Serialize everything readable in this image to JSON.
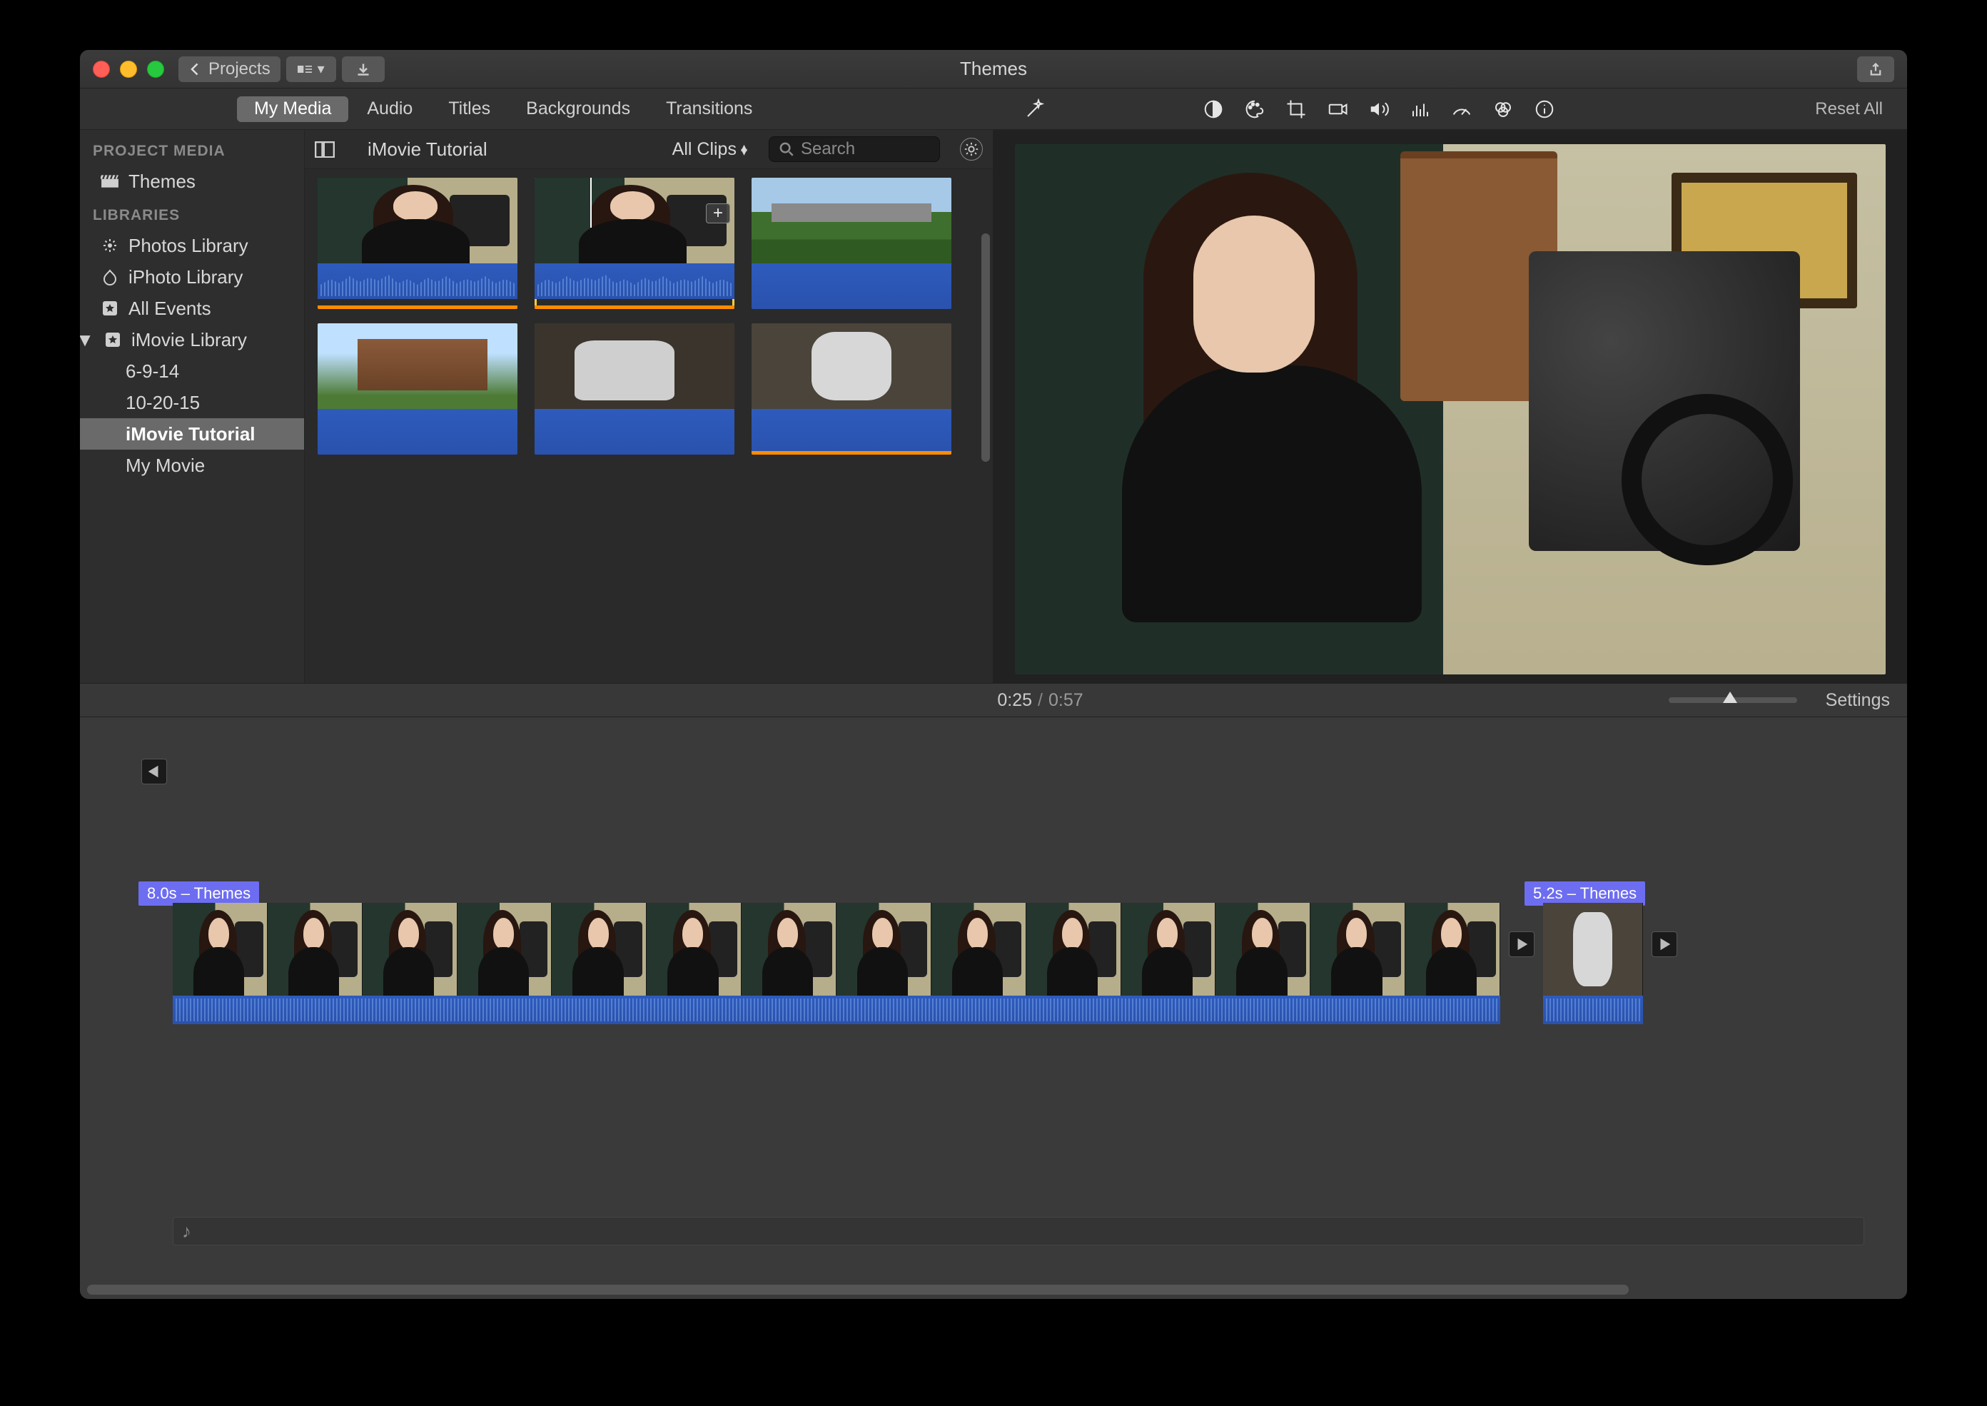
{
  "app_title": "Themes",
  "titlebar": {
    "projects_label": "Projects"
  },
  "tabs": {
    "my_media": "My Media",
    "audio": "Audio",
    "titles": "Titles",
    "backgrounds": "Backgrounds",
    "transitions": "Transitions"
  },
  "toolbar": {
    "reset_all": "Reset All"
  },
  "sidebar": {
    "section_project_media": "PROJECT MEDIA",
    "themes": "Themes",
    "section_libraries": "LIBRARIES",
    "photos_library": "Photos Library",
    "iphoto_library": "iPhoto Library",
    "all_events": "All Events",
    "imovie_library": "iMovie Library",
    "events": [
      {
        "label": "6-9-14"
      },
      {
        "label": "10-20-15"
      },
      {
        "label": "iMovie Tutorial",
        "selected": true
      },
      {
        "label": "My Movie"
      }
    ]
  },
  "media_browser": {
    "title": "iMovie Tutorial",
    "filter_label": "All Clips",
    "search_placeholder": "Search"
  },
  "timebar": {
    "current": "0:25",
    "total": "0:57",
    "settings": "Settings"
  },
  "timeline": {
    "clip1_label": "8.0s – Themes",
    "clip2_label": "5.2s – Themes"
  }
}
